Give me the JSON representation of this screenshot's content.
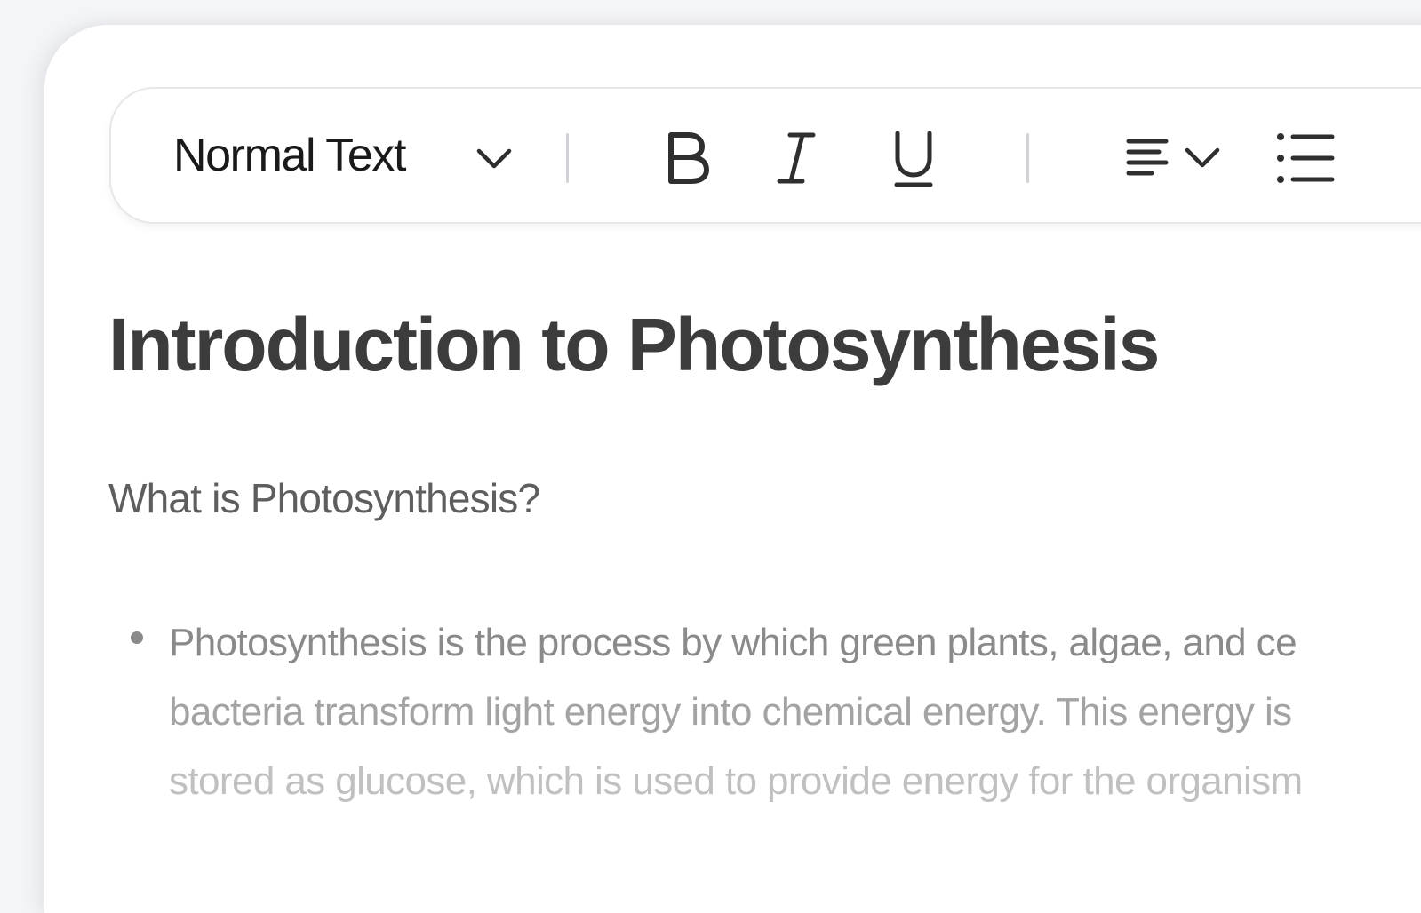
{
  "toolbar": {
    "text_style_label": "Normal Text",
    "icons": {
      "text_style_dropdown": "chevron-down-icon",
      "bold": "bold-icon",
      "italic": "italic-icon",
      "underline": "underline-icon",
      "align": "align-left-icon",
      "align_dropdown": "chevron-down-icon",
      "list": "bullet-list-icon"
    }
  },
  "document": {
    "title": "Introduction to Photosynthesis",
    "subheading": "What is Photosynthesis?",
    "bullet_lines": [
      "Photosynthesis is the process by which green plants, algae, and ce",
      "bacteria transform light energy into chemical energy. This energy is",
      "stored as glucose, which is used to provide energy for the organism"
    ]
  },
  "colors": {
    "icon": "#2f2f2f",
    "title": "#3c3c3c",
    "subheading": "#5e5e5e",
    "body_line_1": "#8a8a8a",
    "body_line_2": "#a3a3a3",
    "body_line_3": "#c0c0c0"
  }
}
